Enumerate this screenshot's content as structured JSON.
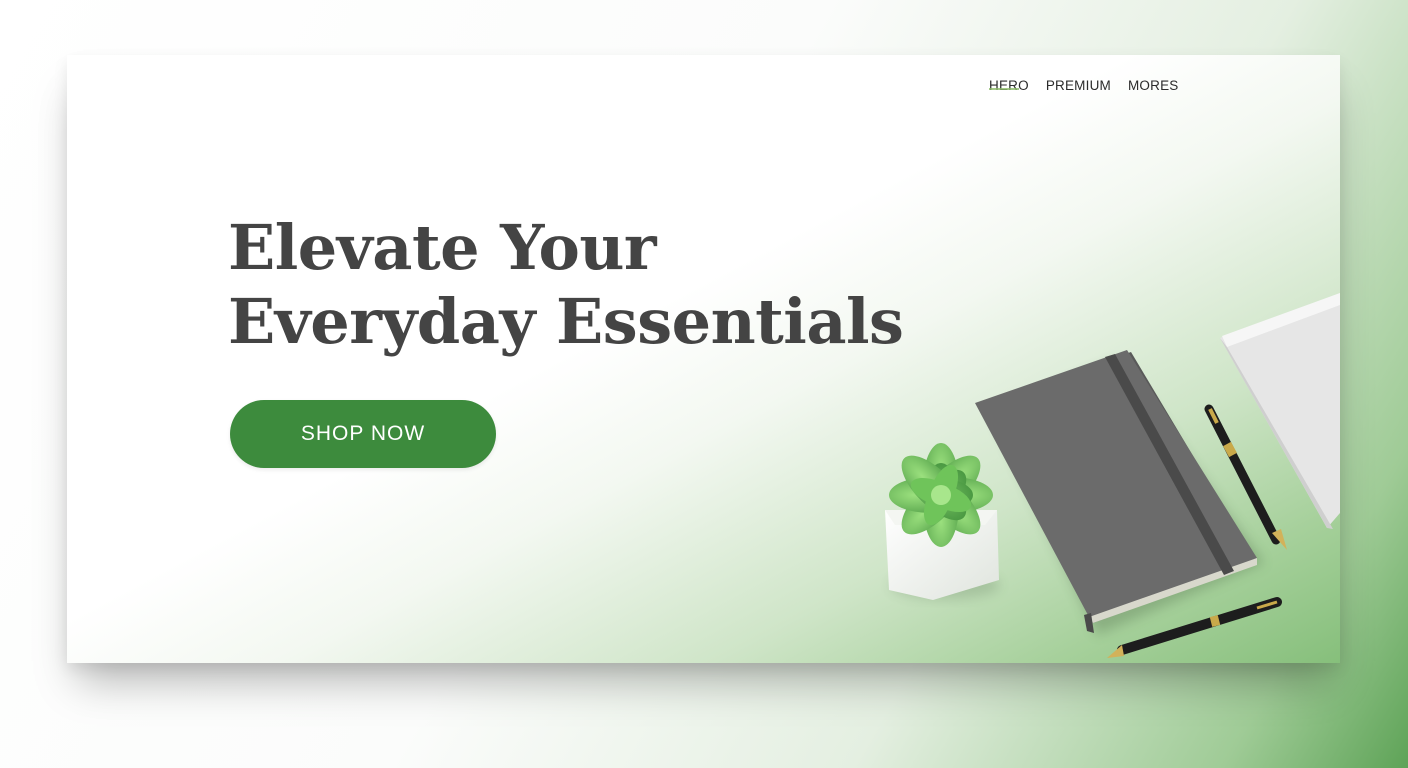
{
  "nav": {
    "items": [
      {
        "label": "HERO",
        "active": true
      },
      {
        "label": "PREMIUM",
        "active": false
      },
      {
        "label": "MORES",
        "active": false
      }
    ]
  },
  "hero": {
    "headline_line1": "Elevate Your",
    "headline_line2": "Everyday Essentials",
    "cta_label": "SHOP NOW"
  },
  "colors": {
    "accent_green": "#3d8b3d",
    "headline_text": "#444444",
    "notebook_gray": "#6b6b6b"
  },
  "illustration_items": [
    "succulent-plant-icon",
    "gray-notebook-icon",
    "pen-icon",
    "white-book-icon"
  ]
}
